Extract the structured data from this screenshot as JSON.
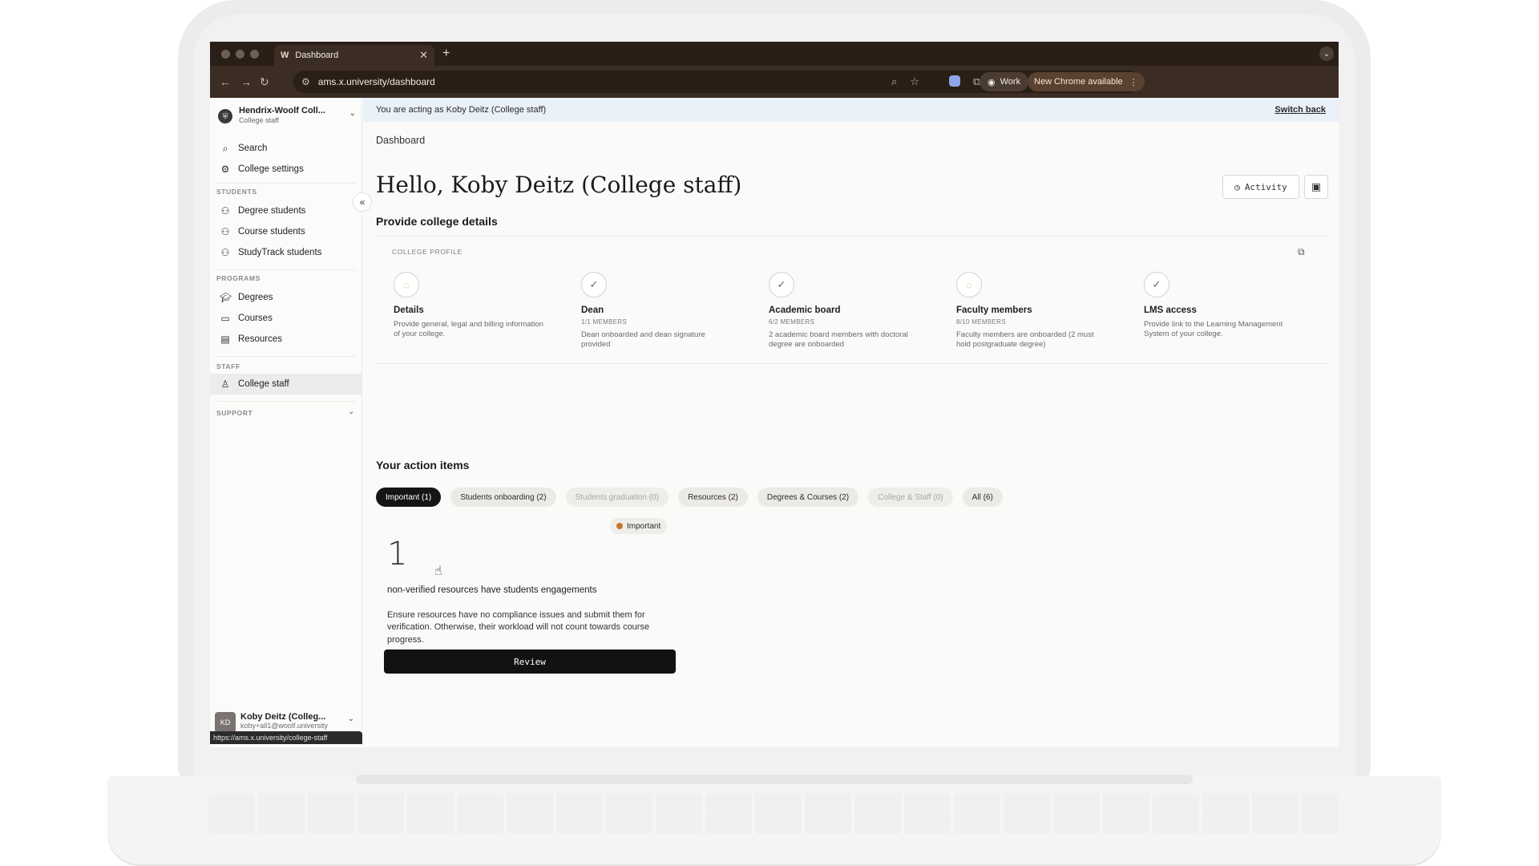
{
  "browser": {
    "tab_title": "Dashboard",
    "tab_favicon": "W",
    "url": "ams.x.university/dashboard",
    "profile": "Work",
    "update": "New Chrome available",
    "status_url": "https://ams.x.university/college-staff"
  },
  "sidebar": {
    "org_name": "Hendrix-Woolf Coll...",
    "org_role": "College staff",
    "top_items": [
      {
        "label": "Search",
        "icon": "search-icon"
      },
      {
        "label": "College settings",
        "icon": "gear-icon"
      }
    ],
    "students_label": "STUDENTS",
    "students_items": [
      {
        "label": "Degree students"
      },
      {
        "label": "Course students"
      },
      {
        "label": "StudyTrack students"
      }
    ],
    "programs_label": "PROGRAMS",
    "programs_items": [
      {
        "label": "Degrees",
        "icon": "graduation-cap-icon"
      },
      {
        "label": "Courses",
        "icon": "book-icon"
      },
      {
        "label": "Resources",
        "icon": "clipboard-icon"
      }
    ],
    "staff_label": "STAFF",
    "staff_items": [
      {
        "label": "College staff",
        "icon": "staff-icon",
        "active": true
      }
    ],
    "support_label": "SUPPORT",
    "user_name": "Koby Deitz (Colleg...",
    "user_email": "koby+all1@woolf.university"
  },
  "banner": {
    "text": "You are acting as Koby Deitz (College staff)",
    "switch_label": "Switch back"
  },
  "main": {
    "breadcrumb": "Dashboard",
    "title": "Hello, Koby Deitz (College staff)",
    "activity_label": "Activity",
    "college_details_title": "Provide college details",
    "college_profile_label": "COLLEGE PROFILE",
    "steps": [
      {
        "title": "Details",
        "sub": "",
        "desc": "Provide general, legal and billing information of your college.",
        "status": "pending"
      },
      {
        "title": "Dean",
        "sub": "1/1 MEMBERS",
        "desc": "Dean onboarded and dean signature provided",
        "status": "done"
      },
      {
        "title": "Academic board",
        "sub": "6/2 MEMBERS",
        "desc": "2 academic board members with doctoral degree are onboarded",
        "status": "done"
      },
      {
        "title": "Faculty members",
        "sub": "8/10 MEMBERS",
        "desc": "Faculty members are onboarded (2 must hold postgraduate degree)",
        "status": "pending"
      },
      {
        "title": "LMS access",
        "sub": "",
        "desc": "Provide link to the Learning Management System of your college.",
        "status": "done"
      }
    ],
    "action_items_title": "Your action items",
    "chips": [
      {
        "label": "Important (1)",
        "state": "active"
      },
      {
        "label": "Students onboarding (2)",
        "state": "normal"
      },
      {
        "label": "Students graduation (0)",
        "state": "disabled"
      },
      {
        "label": "Resources (2)",
        "state": "normal"
      },
      {
        "label": "Degrees & Courses (2)",
        "state": "normal"
      },
      {
        "label": "College & Staff (0)",
        "state": "disabled"
      },
      {
        "label": "All (6)",
        "state": "normal"
      }
    ],
    "card": {
      "badge": "Important",
      "count": "1",
      "headline": "non-verified resources have students engagements",
      "description": "Ensure resources have no compliance issues and submit them for verification. Otherwise, their workload will not count towards course progress.",
      "button": "Review"
    }
  }
}
